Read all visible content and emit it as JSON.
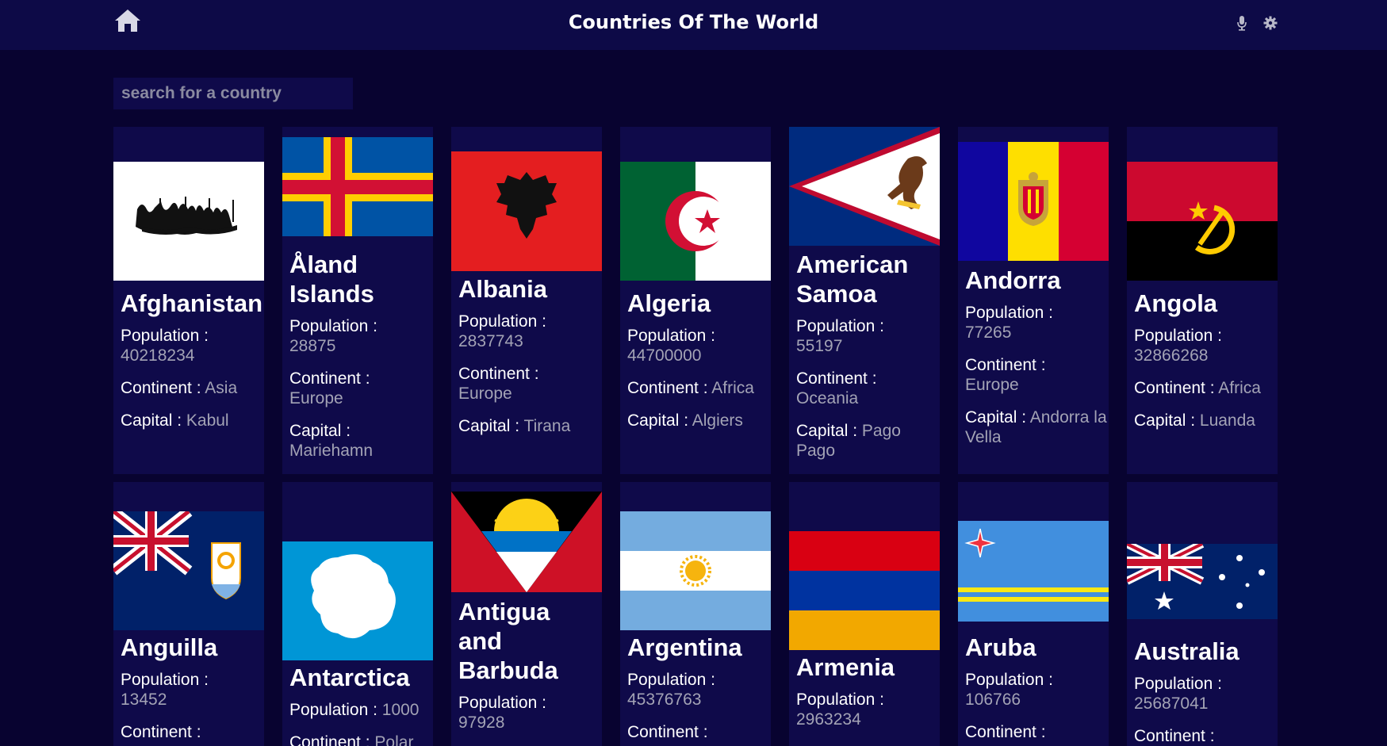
{
  "header": {
    "title": "Countries Of The World",
    "home_icon": "home-icon",
    "mic_icon": "mic-icon",
    "settings_icon": "gear-icon"
  },
  "search": {
    "placeholder": "search for a country",
    "value": ""
  },
  "labels": {
    "population": "Population :",
    "continent": "Continent :",
    "capital": "Capital :"
  },
  "colors": {
    "page_bg": "#080330",
    "header_bg": "#0d0a47",
    "card_bg": "#0f0a4a",
    "muted_text": "#a3a3b5"
  },
  "countries": [
    {
      "name": "Afghanistan",
      "population": "40218234",
      "continent": "Asia",
      "capital": "Kabul"
    },
    {
      "name": "Åland Islands",
      "population": "28875",
      "continent": "Europe",
      "capital": "Mariehamn"
    },
    {
      "name": "Albania",
      "population": "2837743",
      "continent": "Europe",
      "capital": "Tirana"
    },
    {
      "name": "Algeria",
      "population": "44700000",
      "continent": "Africa",
      "capital": "Algiers"
    },
    {
      "name": "American Samoa",
      "population": "55197",
      "continent": "Oceania",
      "capital": "Pago Pago"
    },
    {
      "name": "Andorra",
      "population": "77265",
      "continent": "Europe",
      "capital": "Andorra la Vella"
    },
    {
      "name": "Angola",
      "population": "32866268",
      "continent": "Africa",
      "capital": "Luanda"
    },
    {
      "name": "Anguilla",
      "population": "13452",
      "continent": "",
      "capital": ""
    },
    {
      "name": "Antarctica",
      "population": "1000",
      "continent": "Polar",
      "capital": ""
    },
    {
      "name": "Antigua and Barbuda",
      "population": "97928",
      "continent": "",
      "capital": ""
    },
    {
      "name": "Argentina",
      "population": "45376763",
      "continent": "",
      "capital": ""
    },
    {
      "name": "Armenia",
      "population": "2963234",
      "continent": "",
      "capital": ""
    },
    {
      "name": "Aruba",
      "population": "106766",
      "continent": "",
      "capital": ""
    },
    {
      "name": "Australia",
      "population": "25687041",
      "continent": "",
      "capital": ""
    }
  ]
}
